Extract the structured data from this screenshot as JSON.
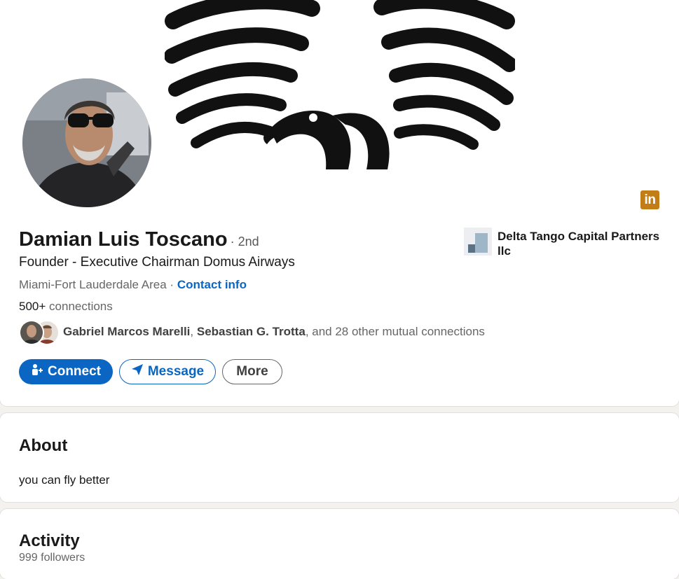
{
  "profile": {
    "name": "Damian Luis Toscano",
    "degree": "· 2nd",
    "headline": "Founder - Executive Chairman Domus Airways",
    "location": "Miami-Fort Lauderdale Area ·",
    "contact_info": "Contact info",
    "connections_count": "500+",
    "connections_label": "connections",
    "mutual": {
      "name1": "Gabriel Marcos Marelli",
      "sep": ",",
      "name2": "Sebastian G. Trotta",
      "rest": ", and 28 other mutual connections"
    },
    "company": "Delta Tango Capital Partners llc"
  },
  "actions": {
    "connect": "Connect",
    "message": "Message",
    "more": "More"
  },
  "badge": {
    "text": "in",
    "color": "#c37d16"
  },
  "about": {
    "title": "About",
    "text": "you can fly better"
  },
  "activity": {
    "title": "Activity",
    "followers": "999 followers"
  },
  "colors": {
    "accent": "#0a66c2",
    "page_bg": "#f3f2ef"
  }
}
